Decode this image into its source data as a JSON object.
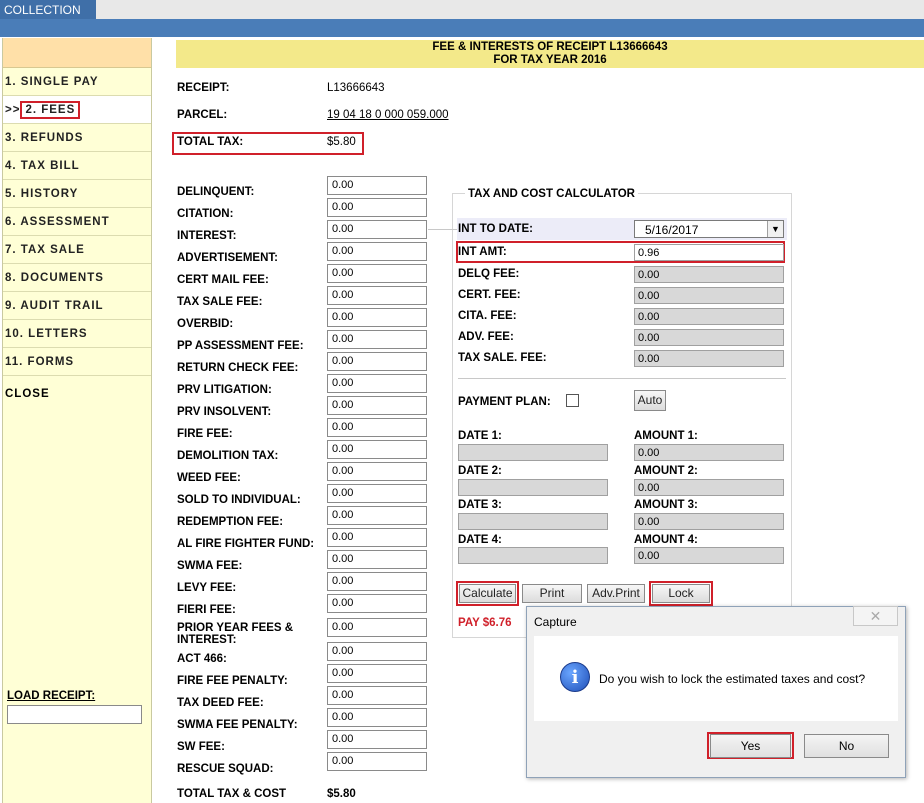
{
  "app_tab": "COLLECTION",
  "header": {
    "line1": "FEE & INTERESTS OF RECEIPT L13666643",
    "line2": "FOR TAX YEAR 2016"
  },
  "sidebar": {
    "active_marker": ">>",
    "items": [
      "1. SINGLE PAY",
      "2. FEES",
      "3. REFUNDS",
      "4. TAX BILL",
      "5. HISTORY",
      "6. ASSESSMENT",
      "7. TAX SALE",
      "8. DOCUMENTS",
      "9. AUDIT TRAIL",
      "10. LETTERS",
      "11. FORMS"
    ],
    "close": "CLOSE",
    "load_receipt_label": "LOAD RECEIPT:",
    "load_receipt_value": ""
  },
  "summary": {
    "receipt_label": "RECEIPT:",
    "receipt_value": "L13666643",
    "parcel_label": "PARCEL:",
    "parcel_value": "19 04 18 0 000 059.000",
    "total_tax_label": "TOTAL TAX:",
    "total_tax_value": "$5.80"
  },
  "fees": [
    {
      "label": "DELINQUENT:",
      "value": "0.00"
    },
    {
      "label": "CITATION:",
      "value": "0.00"
    },
    {
      "label": "INTEREST:",
      "value": "0.00"
    },
    {
      "label": "ADVERTISEMENT:",
      "value": "0.00"
    },
    {
      "label": "CERT MAIL FEE:",
      "value": "0.00"
    },
    {
      "label": "TAX SALE FEE:",
      "value": "0.00"
    },
    {
      "label": "OVERBID:",
      "value": "0.00"
    },
    {
      "label": "PP ASSESSMENT FEE:",
      "value": "0.00"
    },
    {
      "label": "RETURN CHECK FEE:",
      "value": "0.00"
    },
    {
      "label": "PRV LITIGATION:",
      "value": "0.00"
    },
    {
      "label": "PRV INSOLVENT:",
      "value": "0.00"
    },
    {
      "label": "FIRE FEE:",
      "value": "0.00"
    },
    {
      "label": "DEMOLITION TAX:",
      "value": "0.00"
    },
    {
      "label": "WEED FEE:",
      "value": "0.00"
    },
    {
      "label": "SOLD TO INDIVIDUAL:",
      "value": "0.00"
    },
    {
      "label": "REDEMPTION FEE:",
      "value": "0.00"
    },
    {
      "label": "AL FIRE FIGHTER FUND:",
      "value": "0.00"
    },
    {
      "label": "SWMA FEE:",
      "value": "0.00"
    },
    {
      "label": "LEVY FEE:",
      "value": "0.00"
    },
    {
      "label": "FIERI FEE:",
      "value": "0.00"
    },
    {
      "label": "PRIOR YEAR FEES &",
      "label2": "INTEREST:",
      "value": "0.00"
    },
    {
      "label": "ACT 466:",
      "value": "0.00"
    },
    {
      "label": "FIRE FEE PENALTY:",
      "value": "0.00"
    },
    {
      "label": "TAX DEED FEE:",
      "value": "0.00"
    },
    {
      "label": "SWMA FEE PENALTY:",
      "value": "0.00"
    },
    {
      "label": "SW FEE:",
      "value": "0.00"
    },
    {
      "label": "RESCUE SQUAD:",
      "value": "0.00"
    }
  ],
  "total_tax_cost_label": "TOTAL TAX & COST",
  "total_tax_cost_value": "$5.80",
  "calculator": {
    "title": "TAX AND COST CALCULATOR",
    "int_to_date_label": "INT TO DATE:",
    "int_to_date_value": "5/16/2017",
    "int_amt_label": "INT AMT:",
    "int_amt_value": "0.96",
    "delq_fee_label": "DELQ FEE:",
    "delq_fee_value": "0.00",
    "cert_fee_label": "CERT. FEE:",
    "cert_fee_value": "0.00",
    "cita_fee_label": "CITA. FEE:",
    "cita_fee_value": "0.00",
    "adv_fee_label": "ADV. FEE:",
    "adv_fee_value": "0.00",
    "tax_sale_fee_label": "TAX SALE. FEE:",
    "tax_sale_fee_value": "0.00",
    "payment_plan_label": "PAYMENT PLAN:",
    "auto_label": "Auto",
    "date1_label": "DATE 1:",
    "date2_label": "DATE 2:",
    "date3_label": "DATE 3:",
    "date4_label": "DATE 4:",
    "amount1_label": "AMOUNT 1:",
    "amount2_label": "AMOUNT 2:",
    "amount3_label": "AMOUNT 3:",
    "amount4_label": "AMOUNT 4:",
    "amount1_value": "0.00",
    "amount2_value": "0.00",
    "amount3_value": "0.00",
    "amount4_value": "0.00",
    "calculate_label": "Calculate",
    "print_label": "Print",
    "adv_print_label": "Adv.Print",
    "lock_label": "Lock",
    "pay_text": "PAY $6.76"
  },
  "dialog": {
    "title": "Capture",
    "close_glyph": "✕",
    "message": "Do you wish to lock the estimated taxes and cost?",
    "yes_label": "Yes",
    "no_label": "No"
  },
  "colors": {
    "highlight": "#d0202a",
    "header_bg": "#f3e98a",
    "sidebar_bg": "#ffffd6",
    "brand_blue": "#4a7db8",
    "pay_red": "#d0202a"
  }
}
